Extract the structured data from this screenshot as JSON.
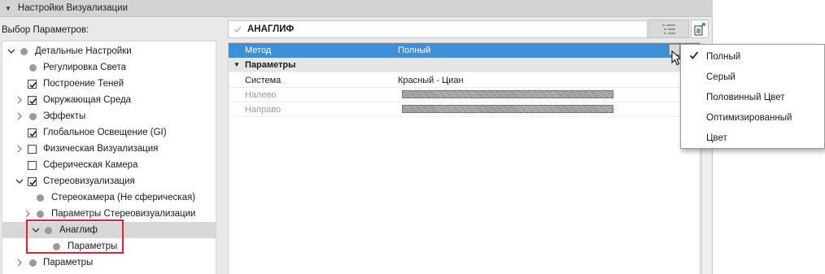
{
  "panel": {
    "title": "Настройки Визуализации"
  },
  "left": {
    "label": "Выбор Параметров:",
    "tree": [
      {
        "label": "Детальные Настройки",
        "expander": "expanded",
        "marker": "dot"
      },
      {
        "label": "Регулировка Света",
        "expander": "none",
        "marker": "dot"
      },
      {
        "label": "Построение Теней",
        "expander": "none",
        "marker": "checkbox",
        "checked": true
      },
      {
        "label": "Окружающая Среда",
        "expander": "collapsed",
        "marker": "checkbox",
        "checked": true
      },
      {
        "label": "Эффекты",
        "expander": "collapsed",
        "marker": "dot"
      },
      {
        "label": "Глобальное Освещение (GI)",
        "expander": "none",
        "marker": "checkbox",
        "checked": true
      },
      {
        "label": "Физическая Визуализация",
        "expander": "collapsed",
        "marker": "checkbox",
        "checked": false
      },
      {
        "label": "Сферическая Камера",
        "expander": "none",
        "marker": "checkbox",
        "checked": false
      },
      {
        "label": "Стереовизуализация",
        "expander": "expanded",
        "marker": "checkbox",
        "checked": true
      },
      {
        "label": "Стереокамера (Не сферическая)",
        "expander": "none",
        "marker": "dot"
      },
      {
        "label": "Параметры Стереовизуализации",
        "expander": "collapsed",
        "marker": "dot"
      },
      {
        "label": "Анаглиф",
        "expander": "expanded",
        "marker": "dot",
        "selected": true
      },
      {
        "label": "Параметры",
        "expander": "none",
        "marker": "dot"
      },
      {
        "label": "Параметры",
        "expander": "collapsed",
        "marker": "dot"
      }
    ]
  },
  "right": {
    "name": "АНАГЛИФ",
    "rows": [
      {
        "key": "Метод",
        "value": "Полный",
        "kind": "selected"
      },
      {
        "key": "Параметры",
        "value": "",
        "kind": "group"
      },
      {
        "key": "Система",
        "value": "Красный - Циан",
        "kind": "normal"
      },
      {
        "key": "Налево",
        "value": "",
        "kind": "disabled"
      },
      {
        "key": "Направо",
        "value": "",
        "kind": "disabled"
      }
    ]
  },
  "menu": {
    "items": [
      {
        "label": "Полный",
        "checked": true
      },
      {
        "label": "Серый",
        "checked": false
      },
      {
        "label": "Половинный Цвет",
        "checked": false
      },
      {
        "label": "Оптимизированный",
        "checked": false
      },
      {
        "label": "Цвет",
        "checked": false
      }
    ]
  },
  "colors": {
    "selection": "#3e8fd9",
    "highlight_box": "#e0202a",
    "panel_bg": "#e9e9e9"
  }
}
